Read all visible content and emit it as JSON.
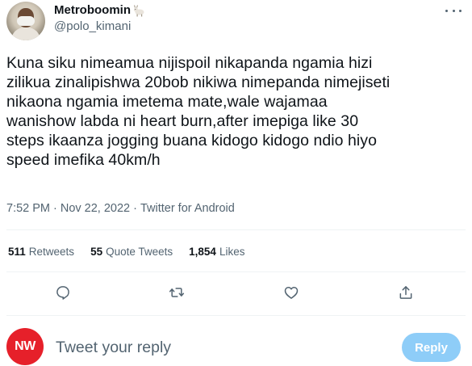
{
  "author": {
    "display_name": "Metroboomin",
    "name_emoji": "goat-emoji",
    "handle": "@polo_kimani"
  },
  "tweet": {
    "text": "Kuna siku nimeamua nijispoil nikapanda ngamia hizi\nzilikua zinalipishwa 20bob nikiwa nimepanda nimejiseti\nnikaona ngamia imetema mate,wale wajamaa\nwanishow labda ni heart burn,after imepiga like 30\nsteps ikaanza jogging buana kidogo kidogo ndio hiyo\nspeed imefika 40km/h",
    "time": "7:52 PM",
    "separator": "·",
    "date": "Nov 22, 2022",
    "source": "Twitter for Android"
  },
  "stats": {
    "retweets": {
      "count": "511",
      "label": "Retweets"
    },
    "quote_tweets": {
      "count": "55",
      "label": "Quote Tweets"
    },
    "likes": {
      "count": "1,854",
      "label": "Likes"
    }
  },
  "actions": [
    "reply-icon",
    "retweet-icon",
    "like-icon",
    "share-icon"
  ],
  "reply": {
    "avatar_text": "NW",
    "avatar_color": "#e6202a",
    "placeholder": "Tweet your reply",
    "button_label": "Reply",
    "button_color": "#8ecdf8"
  },
  "colors": {
    "text_primary": "#0f1419",
    "text_secondary": "#536471",
    "divider": "#eff3f4"
  }
}
